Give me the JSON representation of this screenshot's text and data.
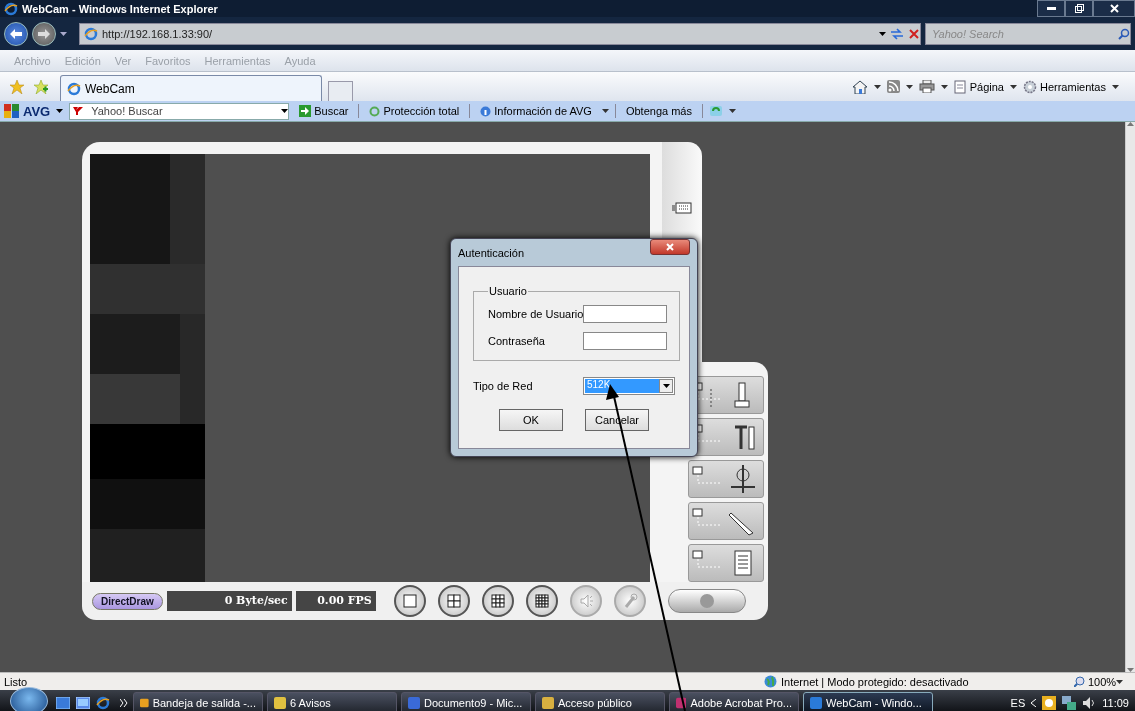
{
  "window": {
    "title": "WebCam - Windows Internet Explorer"
  },
  "address_bar": {
    "url": "http://192.168.1.33:90/",
    "search_placeholder": "Yahoo! Search"
  },
  "menu_bar": {
    "items": [
      "Archivo",
      "Edición",
      "Ver",
      "Favoritos",
      "Herramientas",
      "Ayuda"
    ]
  },
  "tabs": [
    {
      "label": "WebCam",
      "selected": true
    }
  ],
  "command_bar": {
    "items": [
      {
        "kind": "home"
      },
      {
        "kind": "feeds"
      },
      {
        "kind": "print"
      },
      {
        "kind": "page",
        "label": "Página"
      },
      {
        "kind": "tools",
        "label": "Herramientas"
      }
    ]
  },
  "avg_toolbar": {
    "logo": "AVG",
    "search_placeholder": "Yahoo! Buscar",
    "search_button": "Buscar",
    "items": [
      "Protección total",
      "Información de AVG",
      "Obtenga más"
    ]
  },
  "viewer": {
    "mode": "DirectDraw",
    "rate": "0 Byte/sec",
    "fps": "0.00 FPS",
    "side_buttons": [
      {
        "kind": "joystick"
      },
      {
        "kind": "tools"
      },
      {
        "kind": "crosshair"
      },
      {
        "kind": "pen"
      },
      {
        "kind": "document"
      }
    ],
    "view_buttons": [
      {
        "kind": "single",
        "disabled": false
      },
      {
        "kind": "quad",
        "disabled": false
      },
      {
        "kind": "nine",
        "disabled": false
      },
      {
        "kind": "sixteen",
        "disabled": false
      },
      {
        "kind": "speaker",
        "disabled": true
      },
      {
        "kind": "mic",
        "disabled": true
      }
    ]
  },
  "dialog": {
    "title": "Autenticación",
    "group": "Usuario",
    "fields": [
      {
        "label": "Nombre de Usuario"
      },
      {
        "label": "Contraseña"
      }
    ],
    "network_label": "Tipo de Red",
    "network_value": "512K",
    "buttons": [
      "OK",
      "Cancelar"
    ]
  },
  "status_bar": {
    "text": "Listo",
    "zone": "Internet | Modo protegido: desactivado",
    "zoom": "100%"
  },
  "taskbar": {
    "tasks": [
      {
        "label": "Bandeja de salida -...",
        "selected": false
      },
      {
        "label": "6 Avisos",
        "selected": false
      },
      {
        "label": "Documento9 - Mic...",
        "selected": false
      },
      {
        "label": "Acceso público",
        "selected": false
      },
      {
        "label": "Adobe Acrobat Pro...",
        "selected": false
      },
      {
        "label": "WebCam - Windo...",
        "selected": true
      }
    ],
    "language": "ES",
    "clock": "11:09"
  }
}
